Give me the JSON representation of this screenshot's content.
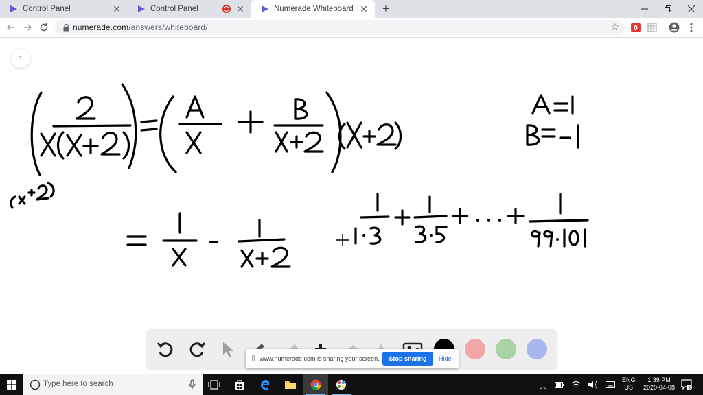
{
  "browser": {
    "tabs": [
      {
        "title": "Control Panel",
        "active": false
      },
      {
        "title": "Control Panel",
        "active": false,
        "recording": true
      },
      {
        "title": "Numerade Whiteboard",
        "active": true
      }
    ],
    "url_host": "numerade.com",
    "url_path": "/answers/whiteboard/",
    "extension_badge": "0"
  },
  "whiteboard": {
    "page_number": "1",
    "colors": {
      "ink": "#000000",
      "swatch_black": "#000000",
      "swatch_red": "#f1a7a7",
      "swatch_green": "#a7d3a7",
      "swatch_blue": "#a9b7f1"
    },
    "tools": [
      "undo-icon",
      "redo-icon",
      "pointer-icon",
      "pen-icon",
      "highlighter-icon",
      "add-icon",
      "eraser-icon",
      "text-icon",
      "image-icon"
    ]
  },
  "share_bar": {
    "message": "www.numerade.com is sharing your screen.",
    "stop_label": "Stop sharing",
    "hide_label": "Hide"
  },
  "taskbar": {
    "search_placeholder": "Type here to search",
    "lang_line1": "ENG",
    "lang_line2": "US",
    "time": "1:39 PM",
    "date": "2020-04-08",
    "notification_count": "3"
  }
}
